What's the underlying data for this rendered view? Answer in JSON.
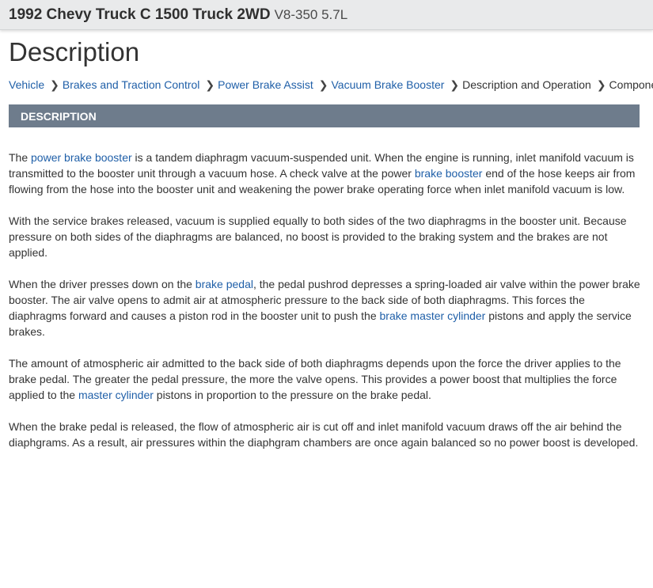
{
  "header": {
    "vehicle": "1992 Chevy Truck C 1500 Truck 2WD",
    "engine": "V8-350 5.7L"
  },
  "page_title": "Description",
  "breadcrumb": [
    {
      "label": "Vehicle",
      "link": true
    },
    {
      "label": "Brakes and Traction Control",
      "link": true
    },
    {
      "label": "Power Brake Assist",
      "link": true
    },
    {
      "label": "Vacuum Brake Booster",
      "link": true
    },
    {
      "label": "Description and Operation",
      "link": false
    },
    {
      "label": "Component",
      "link": false
    }
  ],
  "separator": "❯",
  "section_title": "DESCRIPTION",
  "paragraphs": [
    [
      {
        "t": "The "
      },
      {
        "t": "power brake booster",
        "link": true
      },
      {
        "t": " is a tandem diaphragm vacuum-suspended unit. When the engine is running, inlet manifold vacuum is transmitted to the booster unit through a vacuum hose. A check valve at the power "
      },
      {
        "t": "brake booster",
        "link": true
      },
      {
        "t": " end of the hose keeps air from flowing from the hose into the booster unit and weakening the power brake operating force when inlet manifold vacuum is low."
      }
    ],
    [
      {
        "t": "With the service brakes released, vacuum is supplied equally to both sides of the two diaphragms in the booster unit. Because pressure on both sides of the diaphragms are balanced, no boost is provided to the braking system and the brakes are not applied."
      }
    ],
    [
      {
        "t": "When the driver presses down on the "
      },
      {
        "t": "brake pedal",
        "link": true
      },
      {
        "t": ", the pedal pushrod depresses a spring-loaded air valve within the power brake booster. The air valve opens to admit air at atmospheric pressure to the back side of both diaphragms. This forces the diaphragms forward and causes a piston rod in the booster unit to push the "
      },
      {
        "t": "brake master cylinder",
        "link": true
      },
      {
        "t": " pistons and apply the service brakes."
      }
    ],
    [
      {
        "t": "The amount of atmospheric air admitted to the back side of both diaphragms depends upon the force the driver applies to the brake pedal. The greater the pedal pressure, the more the valve opens. This provides a power boost that multiplies the force applied to the "
      },
      {
        "t": "master cylinder",
        "link": true
      },
      {
        "t": " pistons in proportion to the pressure on the brake pedal."
      }
    ],
    [
      {
        "t": "When the brake pedal is released, the flow of atmospheric air is cut off and inlet manifold vacuum draws off the air behind the diaphgrams. As a result, air pressures within the diaphgram chambers are once again balanced so no power boost is developed."
      }
    ]
  ]
}
